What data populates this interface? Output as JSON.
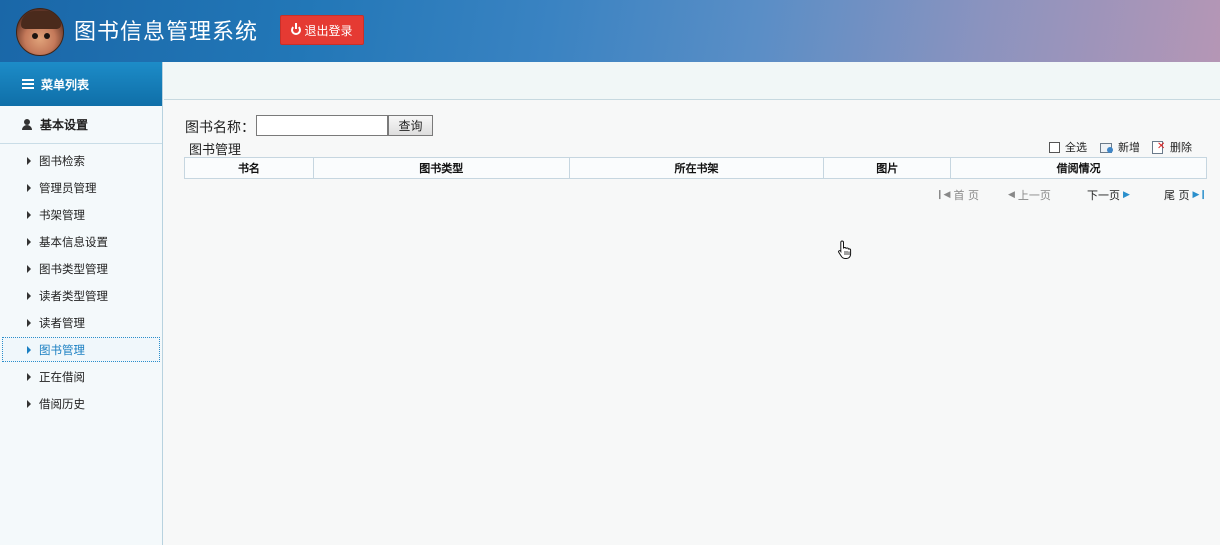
{
  "header": {
    "title": "图书信息管理系统",
    "logout_label": "退出登录",
    "logout_icon": "power-icon"
  },
  "sidebar": {
    "menu_title": "菜单列表",
    "section_title": "基本设置",
    "items": [
      {
        "label": "图书检索",
        "active": false
      },
      {
        "label": "管理员管理",
        "active": false
      },
      {
        "label": "书架管理",
        "active": false
      },
      {
        "label": "基本信息设置",
        "active": false
      },
      {
        "label": "图书类型管理",
        "active": false
      },
      {
        "label": "读者类型管理",
        "active": false
      },
      {
        "label": "读者管理",
        "active": false
      },
      {
        "label": "图书管理",
        "active": true
      },
      {
        "label": "正在借阅",
        "active": false
      },
      {
        "label": "借阅历史",
        "active": false
      }
    ]
  },
  "search": {
    "label": "图书名称：",
    "value": "",
    "button_label": "查询"
  },
  "section": {
    "title": "图书管理"
  },
  "toolbar": {
    "select_all": "全选",
    "add": "新增",
    "delete": "删除"
  },
  "table": {
    "columns": [
      "书名",
      "图书类型",
      "所在书架",
      "图片",
      "借阅情况"
    ],
    "rows": []
  },
  "pagination": {
    "first": "首 页",
    "prev": "上一页",
    "next": "下一页",
    "last": "尾 页"
  },
  "colors": {
    "accent": "#1a7fc2",
    "logout": "#e53a33",
    "menu_head": "#1577b6"
  }
}
